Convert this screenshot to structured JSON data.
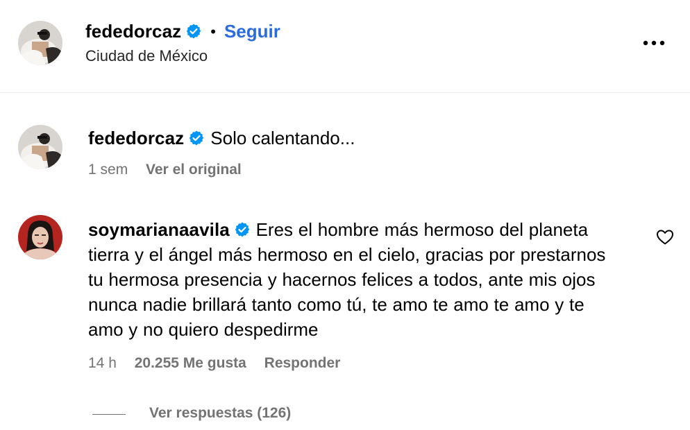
{
  "header": {
    "username": "fededorcaz",
    "separator": "•",
    "follow_label": "Seguir",
    "location": "Ciudad de México"
  },
  "caption": {
    "username": "fededorcaz",
    "text": "Solo calentando...",
    "time": "1 sem",
    "see_original_label": "Ver el original"
  },
  "comment": {
    "username": "soymarianaavila",
    "text": "Eres el hombre más hermoso del planeta tierra y el ángel más hermoso en el cielo, gracias por prestarnos tu hermosa presencia y hacernos felices a todos, ante mis ojos nunca nadie brillará tanto como tú, te amo te amo te amo y te amo y no quiero despedirme",
    "time": "14 h",
    "likes": "20.255 Me gusta",
    "reply_label": "Responder",
    "view_replies_label": "Ver respuestas (126)"
  },
  "icons": {
    "verified": "verified-badge-icon",
    "more": "more-options-icon",
    "like": "heart-icon"
  },
  "colors": {
    "accent": "#2b6be0",
    "verified": "#0095f6",
    "muted": "#737373"
  }
}
